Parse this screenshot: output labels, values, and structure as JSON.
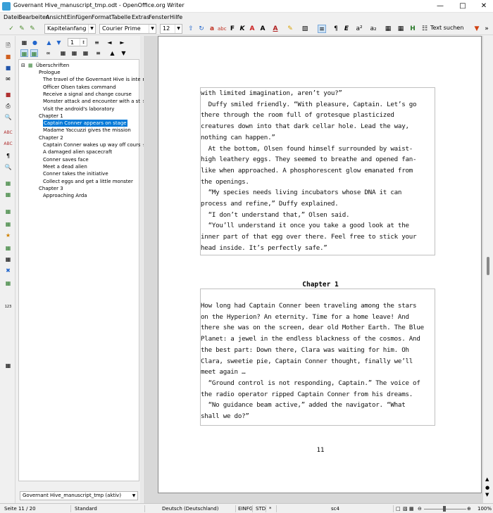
{
  "window": {
    "title": "Governant Hive_manuscript_tmp.odt - OpenOffice.org Writer"
  },
  "menu": [
    "Datei",
    "Bearbeiten",
    "Ansicht",
    "Einfügen",
    "Format",
    "Tabelle",
    "Extras",
    "Fenster",
    "Hilfe"
  ],
  "toolbar": {
    "paragraph_style": "Kapitelanfang",
    "font_name": "Courier Prime",
    "font_size": "12",
    "find_label": "Text suchen"
  },
  "navigator": {
    "page_value": "1",
    "root": "Überschriften",
    "items": [
      {
        "label": "Prologue",
        "level": 1
      },
      {
        "label": "The travel of the Governant Hive is interrupt",
        "level": 2
      },
      {
        "label": "Officer Olsen takes command",
        "level": 2
      },
      {
        "label": "Receive a signal and change course",
        "level": 2
      },
      {
        "label": "Monster attack and encounter with a strange",
        "level": 2
      },
      {
        "label": "Visit the android's laboratory",
        "level": 2
      },
      {
        "label": "Chapter 1",
        "level": 1
      },
      {
        "label": "Captain Conner appears on stage",
        "level": 2,
        "selected": true
      },
      {
        "label": "Madame Yaccuzzi gives the mission",
        "level": 2
      },
      {
        "label": "Chapter 2",
        "level": 1
      },
      {
        "label": "Captain Conner wakes up way off course",
        "level": 2
      },
      {
        "label": "A damaged alien spacecraft",
        "level": 2
      },
      {
        "label": "Conner saves face",
        "level": 2
      },
      {
        "label": "Meet a dead alien",
        "level": 2
      },
      {
        "label": "Conner takes the initiative",
        "level": 2
      },
      {
        "label": "Collect eggs and get a little monster",
        "level": 2
      },
      {
        "label": "Chapter 3",
        "level": 1
      },
      {
        "label": "Approaching Arda",
        "level": 2
      }
    ],
    "document": "Governant Hive_manuscript_tmp (aktiv)"
  },
  "document": {
    "frame1_lines": [
      "with limited imagination, aren’t you?”",
      "  Duffy smiled friendly. “With pleasure, Captain. Let’s go",
      "there through the room full of grotesque plasticized",
      "creatures down into that dark cellar hole. Lead the way,",
      "nothing can happen.”",
      "  At the bottom, Olsen found himself surrounded by waist-",
      "high leathery eggs. They seemed to breathe and opened fan-",
      "like when approached. A phosphorescent glow emanated from",
      "the openings.",
      "  “My species needs living incubators whose DNA it can",
      "process and refine,” Duffy explained.",
      "  “I don’t understand that,” Olsen said.",
      "  “You’ll understand it once you take a good look at the",
      "inner part of that egg over there. Feel free to stick your",
      "head inside. It’s perfectly safe.”"
    ],
    "chapter_title": "Chapter 1",
    "frame2_lines": [
      "How long had Captain Conner been traveling among the stars",
      "on the Hyperion? An eternity. Time for a home leave! And",
      "there she was on the screen, dear old Mother Earth. The Blue",
      "Planet: a jewel in the endless blackness of the cosmos. And",
      "the best part: Down there, Clara was waiting for him. Oh",
      "Clara, sweetie pie, Captain Conner thought, finally we’ll",
      "meet again …",
      "  “Ground control is not responding, Captain.” The voice of",
      "the radio operator ripped Captain Conner from his dreams.",
      "  “No guidance beam active,” added the navigator. “What",
      "shall we do?”"
    ],
    "page_number": "11"
  },
  "statusbar": {
    "page": "Seite 11 / 20",
    "style": "Standard",
    "language": "Deutsch (Deutschland)",
    "insert_mode": "EINFG",
    "selection_mode": "STD",
    "modified": "*",
    "section": "sc4",
    "zoom": "100%"
  }
}
